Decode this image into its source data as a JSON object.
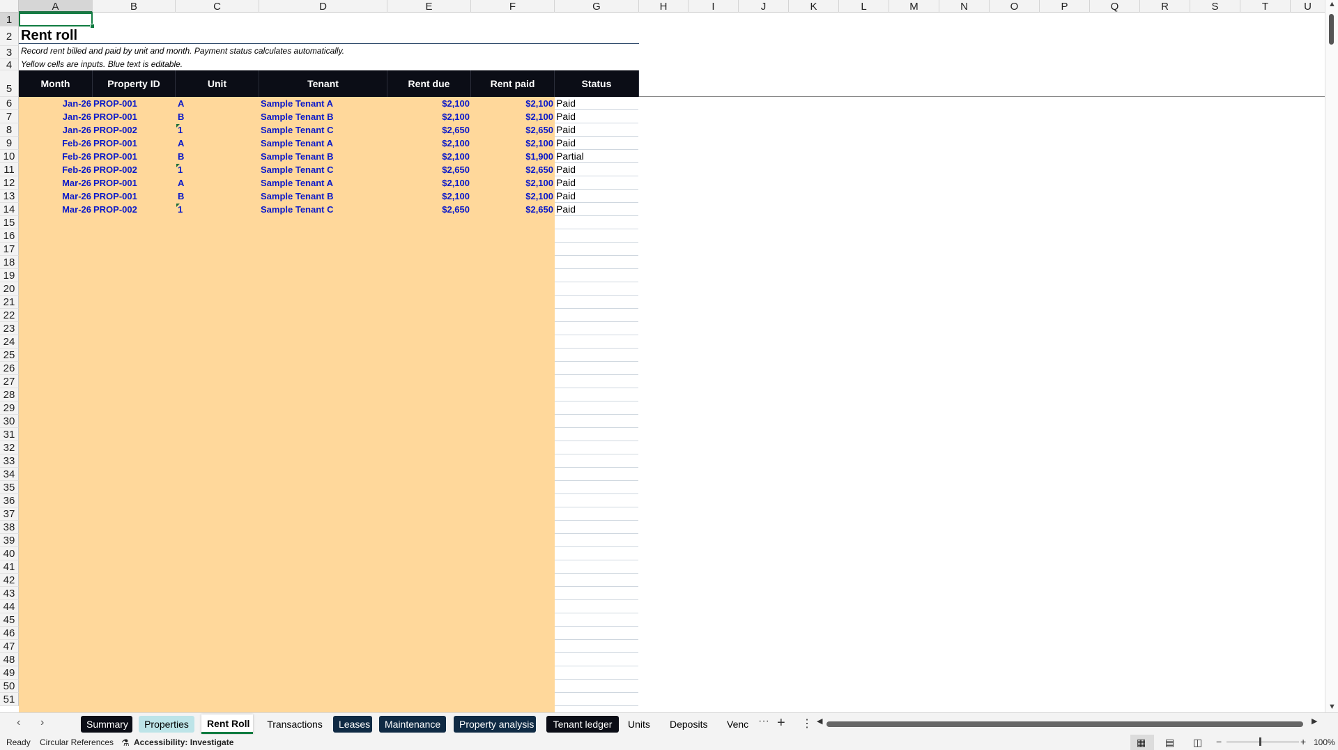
{
  "sheet": {
    "columns": [
      "A",
      "B",
      "C",
      "D",
      "E",
      "F",
      "G",
      "H",
      "I",
      "J",
      "K",
      "L",
      "M",
      "N",
      "O",
      "P",
      "Q",
      "R",
      "S",
      "T",
      "U"
    ],
    "selected_cell": "A1",
    "title": "Rent roll",
    "subtitle_1": "Record rent billed and paid by unit and month. Payment status calculates automatically.",
    "subtitle_2": "Yellow cells are inputs. Blue text is editable.",
    "headers": [
      "Month",
      "Property ID",
      "Unit",
      "Tenant",
      "Rent due",
      "Rent paid",
      "Status"
    ],
    "rows": [
      {
        "month": "Jan-26",
        "property": "PROP-001",
        "unit": "A",
        "tenant": "Sample Tenant A",
        "due": "$2,100",
        "paid": "$2,100",
        "status": "Paid"
      },
      {
        "month": "Jan-26",
        "property": "PROP-001",
        "unit": "B",
        "tenant": "Sample Tenant B",
        "due": "$2,100",
        "paid": "$2,100",
        "status": "Paid"
      },
      {
        "month": "Jan-26",
        "property": "PROP-002",
        "unit": "1",
        "tenant": "Sample Tenant C",
        "due": "$2,650",
        "paid": "$2,650",
        "status": "Paid"
      },
      {
        "month": "Feb-26",
        "property": "PROP-001",
        "unit": "A",
        "tenant": "Sample Tenant A",
        "due": "$2,100",
        "paid": "$2,100",
        "status": "Paid"
      },
      {
        "month": "Feb-26",
        "property": "PROP-001",
        "unit": "B",
        "tenant": "Sample Tenant B",
        "due": "$2,100",
        "paid": "$1,900",
        "status": "Partial"
      },
      {
        "month": "Feb-26",
        "property": "PROP-002",
        "unit": "1",
        "tenant": "Sample Tenant C",
        "due": "$2,650",
        "paid": "$2,650",
        "status": "Paid"
      },
      {
        "month": "Mar-26",
        "property": "PROP-001",
        "unit": "A",
        "tenant": "Sample Tenant A",
        "due": "$2,100",
        "paid": "$2,100",
        "status": "Paid"
      },
      {
        "month": "Mar-26",
        "property": "PROP-001",
        "unit": "B",
        "tenant": "Sample Tenant B",
        "due": "$2,100",
        "paid": "$2,100",
        "status": "Paid"
      },
      {
        "month": "Mar-26",
        "property": "PROP-002",
        "unit": "1",
        "tenant": "Sample Tenant C",
        "due": "$2,650",
        "paid": "$2,650",
        "status": "Paid"
      }
    ],
    "first_row": 1,
    "last_row": 51
  },
  "tabs": [
    {
      "label": "Summary",
      "style": "dark"
    },
    {
      "label": "Properties",
      "style": "teal"
    },
    {
      "label": "Rent Roll",
      "style": "active"
    },
    {
      "label": "Transactions",
      "style": "plain"
    },
    {
      "label": "Leases",
      "style": "navy"
    },
    {
      "label": "Maintenance",
      "style": "navy"
    },
    {
      "label": "Property analysis",
      "style": "navy"
    },
    {
      "label": "Tenant ledger",
      "style": "dark"
    },
    {
      "label": "Units",
      "style": "plain"
    },
    {
      "label": "Deposits",
      "style": "plain"
    },
    {
      "label": "Venc",
      "style": "plain"
    }
  ],
  "tabbar": {
    "prev_icon": "chevron-left-icon",
    "next_icon": "chevron-right-icon",
    "more_tabs": "···",
    "add_sheet": "+",
    "options": "⋮"
  },
  "statusbar": {
    "ready": "Ready",
    "circular": "Circular References",
    "accessibility": "Accessibility: Investigate",
    "zoom": "100%"
  }
}
